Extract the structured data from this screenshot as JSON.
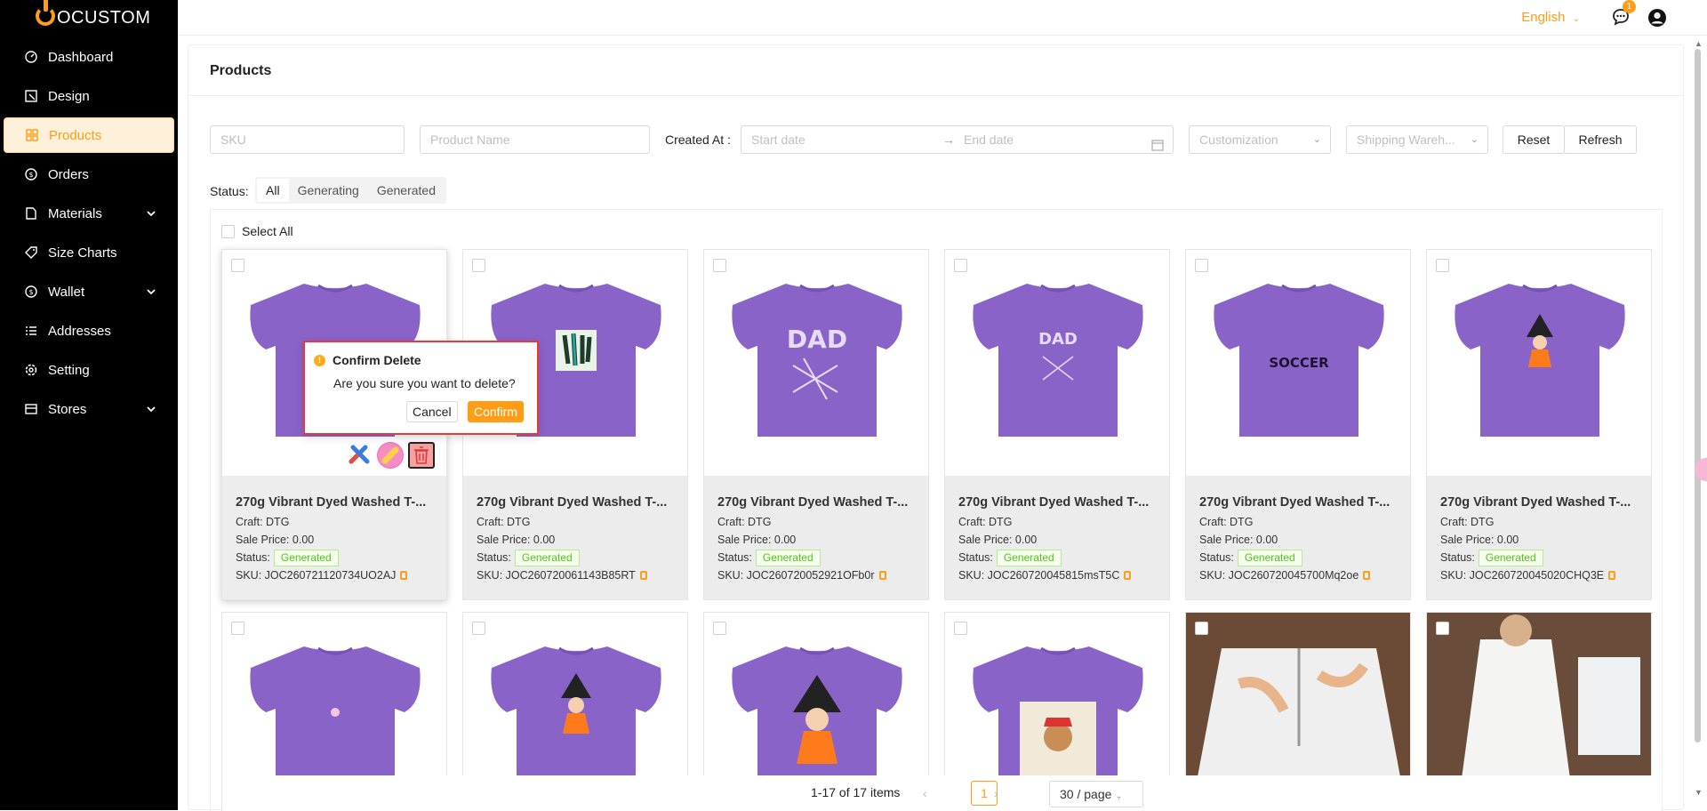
{
  "app": {
    "brand": "JOCUSTOM",
    "brand_display": "OCUSTOM"
  },
  "sidebar": {
    "items": [
      {
        "label": "Dashboard",
        "icon": "dashboard-icon"
      },
      {
        "label": "Design",
        "icon": "design-icon"
      },
      {
        "label": "Products",
        "icon": "products-icon",
        "active": true
      },
      {
        "label": "Orders",
        "icon": "orders-icon"
      },
      {
        "label": "Materials",
        "icon": "materials-icon",
        "expandable": true
      },
      {
        "label": "Size Charts",
        "icon": "tag-icon"
      },
      {
        "label": "Wallet",
        "icon": "wallet-icon",
        "expandable": true
      },
      {
        "label": "Addresses",
        "icon": "list-icon"
      },
      {
        "label": "Setting",
        "icon": "gear-icon"
      },
      {
        "label": "Stores",
        "icon": "store-icon",
        "expandable": true
      }
    ]
  },
  "header": {
    "language": "English",
    "notification_count": "1"
  },
  "page": {
    "title": "Products"
  },
  "filters": {
    "sku_placeholder": "SKU",
    "product_name_placeholder": "Product Name",
    "created_at_label": "Created At",
    "start_date_placeholder": "Start date",
    "end_date_placeholder": "End date",
    "customization_placeholder": "Customization",
    "warehouse_placeholder": "Shipping Wareh...",
    "reset_label": "Reset",
    "refresh_label": "Refresh"
  },
  "status_filter": {
    "label": "Status:",
    "options": [
      "All",
      "Generating",
      "Generated"
    ],
    "selected": "All"
  },
  "select_all_label": "Select All",
  "products": [
    {
      "name": "270g Vibrant Dyed Washed T-...",
      "craft": "Craft: DTG",
      "price": "Sale Price: 0.00",
      "status_label": "Status:",
      "status": "Generated",
      "sku": "SKU: JOC260721120734UO2AJ",
      "print": "none"
    },
    {
      "name": "270g Vibrant Dyed Washed T-...",
      "craft": "Craft: DTG",
      "price": "Sale Price: 0.00",
      "status_label": "Status:",
      "status": "Generated",
      "sku": "SKU: JOC260720061143B85RT",
      "print": "feathers"
    },
    {
      "name": "270g Vibrant Dyed Washed T-...",
      "craft": "Craft: DTG",
      "price": "Sale Price: 0.00",
      "status_label": "Status:",
      "status": "Generated",
      "sku": "SKU: JOC260720052921OFb0r",
      "print": "DAD"
    },
    {
      "name": "270g Vibrant Dyed Washed T-...",
      "craft": "Craft: DTG",
      "price": "Sale Price: 0.00",
      "status_label": "Status:",
      "status": "Generated",
      "sku": "SKU: JOC260720045815msT5C",
      "print": "DAD"
    },
    {
      "name": "270g Vibrant Dyed Washed T-...",
      "craft": "Craft: DTG",
      "price": "Sale Price: 0.00",
      "status_label": "Status:",
      "status": "Generated",
      "sku": "SKU: JOC260720045700Mq2oe",
      "print": "SOCCER"
    },
    {
      "name": "270g Vibrant Dyed Washed T-...",
      "craft": "Craft: DTG",
      "price": "Sale Price: 0.00",
      "status_label": "Status:",
      "status": "Generated",
      "sku": "SKU: JOC260720045020CHQ3E",
      "print": "witch"
    }
  ],
  "products_row2": [
    {
      "print": "heart"
    },
    {
      "print": "witch"
    },
    {
      "print": "witch"
    },
    {
      "print": "dog"
    },
    {
      "print": "polo-photo"
    },
    {
      "print": "dress-photo"
    }
  ],
  "popconfirm": {
    "title": "Confirm Delete",
    "message": "Are you sure you want to delete?",
    "cancel": "Cancel",
    "confirm": "Confirm"
  },
  "pagination": {
    "summary": "1-17 of 17 items",
    "current": "1",
    "page_size": "30 / page"
  },
  "colors": {
    "accent": "#ff9d16",
    "shirt": "#8a63c8",
    "success": "#52c41a",
    "sidebar": "#000000"
  }
}
